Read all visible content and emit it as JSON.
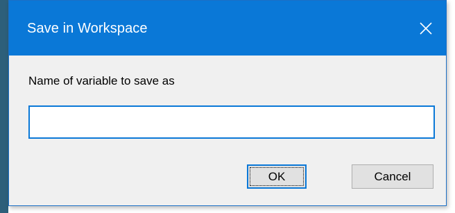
{
  "dialog": {
    "title": "Save in Workspace",
    "close_icon": "close-icon",
    "prompt": "Name of variable to save as",
    "input": {
      "value": "",
      "placeholder": ""
    },
    "ok_label": "OK",
    "cancel_label": "Cancel"
  },
  "colors": {
    "titlebar": "#0a78d7",
    "dialog_background": "#f0f0f0",
    "button_face": "#e1e1e1",
    "focus_border": "#0a78d7"
  }
}
